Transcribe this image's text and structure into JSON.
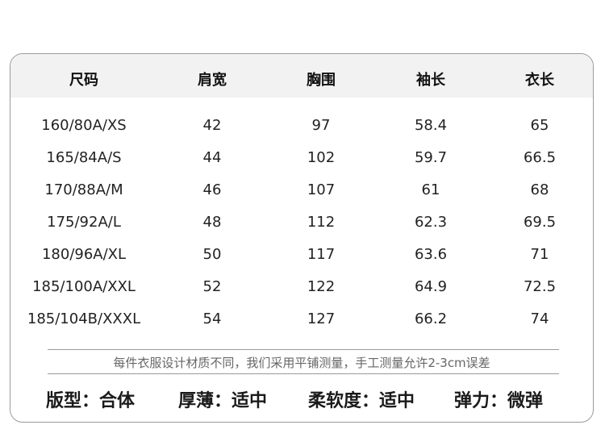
{
  "table": {
    "headers": [
      "尺码",
      "肩宽",
      "胸围",
      "袖长",
      "衣长"
    ],
    "rows": [
      [
        "160/80A/XS",
        "42",
        "97",
        "58.4",
        "65"
      ],
      [
        "165/84A/S",
        "44",
        "102",
        "59.7",
        "66.5"
      ],
      [
        "170/88A/M",
        "46",
        "107",
        "61",
        "68"
      ],
      [
        "175/92A/L",
        "48",
        "112",
        "62.3",
        "69.5"
      ],
      [
        "180/96A/XL",
        "50",
        "117",
        "63.6",
        "71"
      ],
      [
        "185/100A/XXL",
        "52",
        "122",
        "64.9",
        "72.5"
      ],
      [
        "185/104B/XXXL",
        "54",
        "127",
        "66.2",
        "74"
      ]
    ]
  },
  "note": "每件衣服设计材质不同，我们采用平铺测量，手工测量允许2-3cm误差",
  "attributes": [
    "版型：合体",
    "厚薄：适中",
    "柔软度：适中",
    "弹力：微弹"
  ]
}
